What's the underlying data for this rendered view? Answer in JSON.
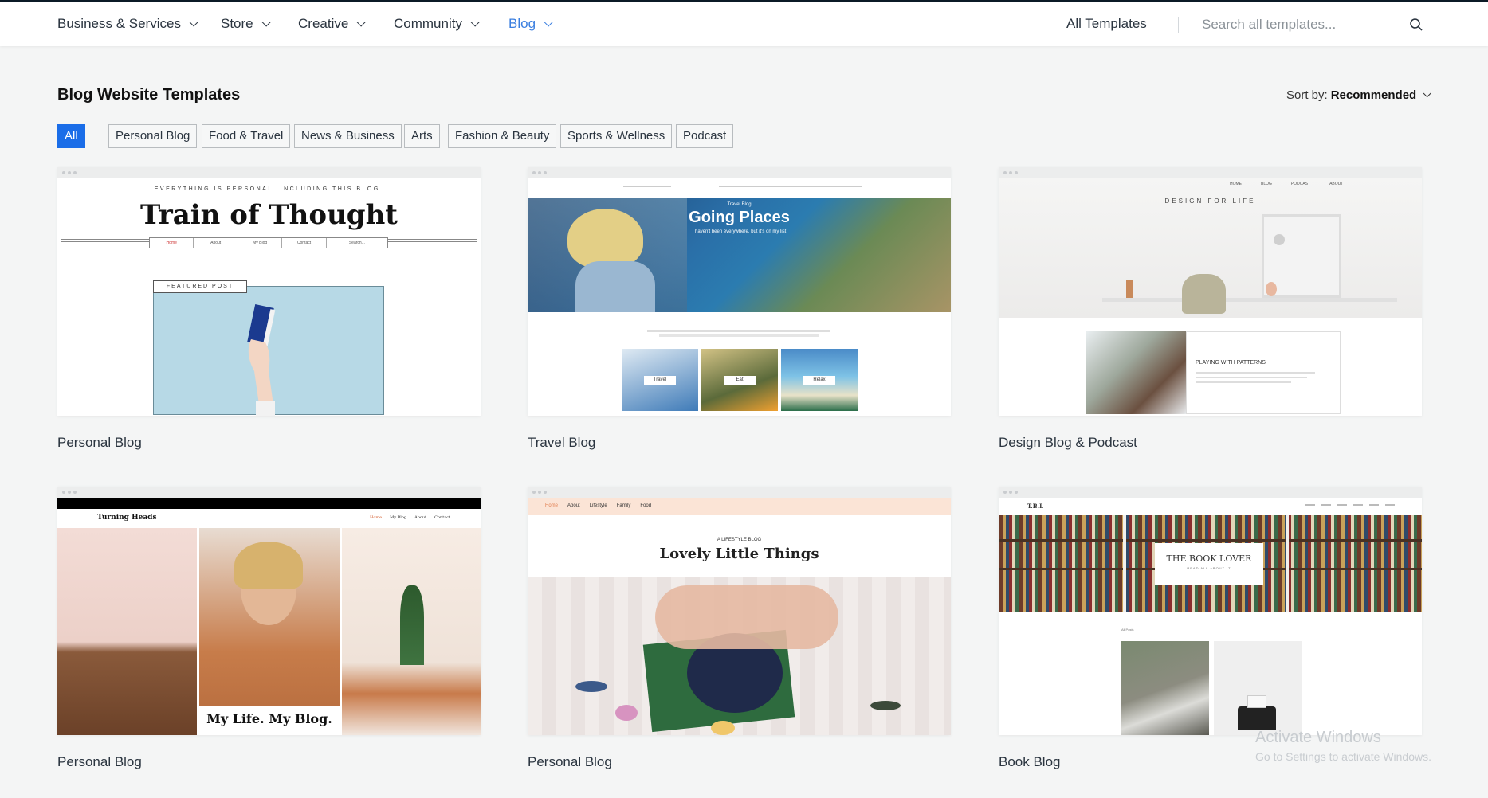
{
  "nav": {
    "items": [
      {
        "label": "Business & Services"
      },
      {
        "label": "Store"
      },
      {
        "label": "Creative"
      },
      {
        "label": "Community"
      },
      {
        "label": "Blog"
      }
    ],
    "all_templates": "All Templates",
    "search_placeholder": "Search all templates..."
  },
  "page": {
    "title": "Blog Website Templates",
    "sort_label": "Sort by:",
    "sort_value": "Recommended"
  },
  "filters": [
    "All",
    "Personal Blog",
    "Food & Travel",
    "News & Business",
    "Arts",
    "Fashion & Beauty",
    "Sports & Wellness",
    "Podcast"
  ],
  "templates": [
    {
      "label": "Personal Blog",
      "preview": {
        "tagline": "EVERYTHING IS PERSONAL. INCLUDING THIS BLOG.",
        "title": "Train of Thought",
        "badge": "FEATURED POST",
        "menu": [
          "Home",
          "About",
          "My Blog",
          "Contact",
          "Search..."
        ]
      }
    },
    {
      "label": "Travel Blog",
      "preview": {
        "kicker": "Travel Blog",
        "title": "Going Places",
        "subtitle": "I haven't been everywhere, but it's on my list",
        "tiles": [
          "Travel",
          "Eat",
          "Relax"
        ]
      }
    },
    {
      "label": "Design Blog & Podcast",
      "preview": {
        "title": "DESIGN FOR LIFE",
        "post_title": "PLAYING WITH PATTERNS",
        "menu": [
          "HOME",
          "BLOG",
          "PODCAST",
          "ABOUT"
        ]
      }
    },
    {
      "label": "Personal Blog",
      "preview": {
        "brand": "Turning Heads",
        "title": "My Life. My Blog.",
        "menu": [
          "Home",
          "My Blog",
          "About",
          "Contact"
        ]
      }
    },
    {
      "label": "Personal Blog",
      "preview": {
        "kicker": "A LIFESTYLE BLOG",
        "title": "Lovely Little Things",
        "menu": [
          "Home",
          "About",
          "Lifestyle",
          "Family",
          "Food"
        ]
      }
    },
    {
      "label": "Book Blog",
      "preview": {
        "brand": "T.B.L",
        "title": "THE BOOK LOVER",
        "subtitle": "READ ALL ABOUT IT",
        "section": "All Posts"
      }
    }
  ],
  "watermark": {
    "line1": "Activate Windows",
    "line2": "Go to Settings to activate Windows."
  },
  "colors": {
    "accent": "#1a6de8",
    "nav_active": "#3b7fe0",
    "background": "#f4f5f5"
  }
}
